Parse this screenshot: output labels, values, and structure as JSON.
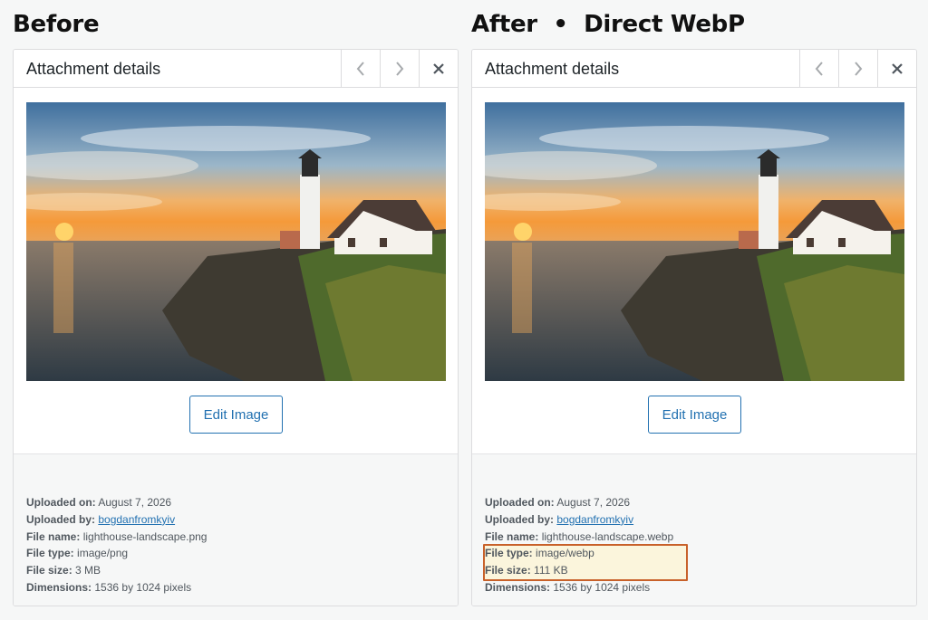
{
  "left": {
    "heading": "Before",
    "panel_title": "Attachment details",
    "edit_button": "Edit Image",
    "meta": {
      "uploaded_on_label": "Uploaded on:",
      "uploaded_on": "August 7, 2026",
      "uploaded_by_label": "Uploaded by:",
      "uploaded_by": "bogdanfromkyiv",
      "file_name_label": "File name:",
      "file_name": "lighthouse-landscape.png",
      "file_type_label": "File type:",
      "file_type": "image/png",
      "file_size_label": "File size:",
      "file_size": "3 MB",
      "dimensions_label": "Dimensions:",
      "dimensions": "1536 by 1024 pixels"
    }
  },
  "right": {
    "heading": "After  •  Direct WebP",
    "panel_title": "Attachment details",
    "edit_button": "Edit Image",
    "meta": {
      "uploaded_on_label": "Uploaded on:",
      "uploaded_on": "August 7, 2026",
      "uploaded_by_label": "Uploaded by:",
      "uploaded_by": "bogdanfromkyiv",
      "file_name_label": "File name:",
      "file_name": "lighthouse-landscape.webp",
      "file_type_label": "File type:",
      "file_type": "image/webp",
      "file_size_label": "File size:",
      "file_size": "111 KB",
      "dimensions_label": "Dimensions:",
      "dimensions": "1536 by 1024 pixels"
    }
  },
  "icons": {
    "prev": "chevron-left-icon",
    "next": "chevron-right-icon",
    "close": "close-icon"
  },
  "colors": {
    "link": "#2271b1",
    "highlight_border": "#c8612a",
    "highlight_fill": "#fbf5dc"
  }
}
